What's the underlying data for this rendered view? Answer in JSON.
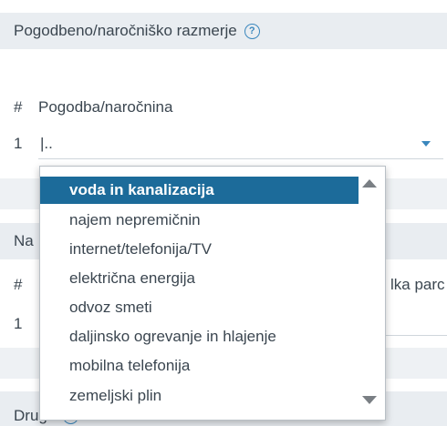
{
  "section1": {
    "title": "Pogodbeno/naročniško razmerje",
    "help_icon": "question-circle-icon",
    "table": {
      "col_num": "#",
      "col_label": "Pogodba/naročnina",
      "row_num": "1",
      "row_value": "|.."
    }
  },
  "section2": {
    "title_partial": "Na",
    "col_num": "#",
    "col_right_partial": "lka parc",
    "row_num": "1"
  },
  "section3": {
    "title_partial": "Drugo",
    "help_icon": "question-circle-icon"
  },
  "dropdown": {
    "selected_index": 0,
    "options": [
      "voda in kanalizacija",
      "najem nepremičnin",
      "internet/telefonija/TV",
      "električna energija",
      "odvoz smeti",
      "daljinsko ogrevanje in hlajenje",
      "mobilna telefonija",
      "zemeljski plin"
    ]
  },
  "colors": {
    "accent": "#3a87bd",
    "selected_bg": "#1c6b9a",
    "header_bg": "#e9edf1"
  }
}
